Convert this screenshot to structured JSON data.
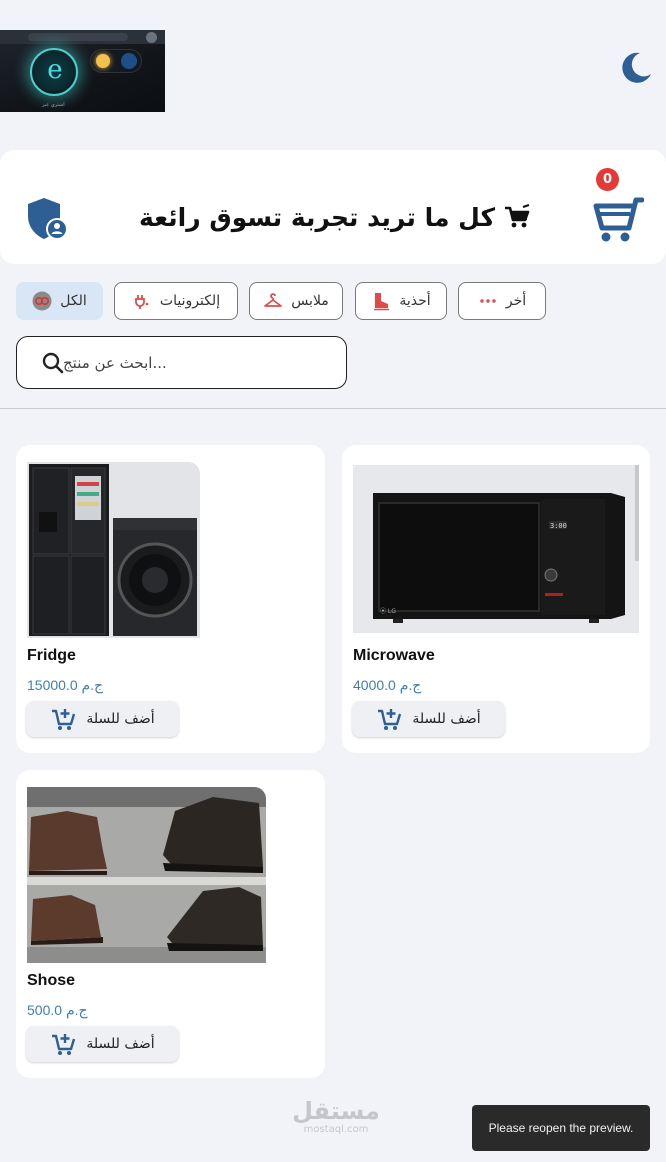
{
  "banner": {
    "tagline": "اشتري عبر",
    "logo_letter": "e"
  },
  "theme": {
    "icon": "moon-icon"
  },
  "header": {
    "title": "كل ما تريد تجربة تسوق رائعة",
    "cart_count": "0",
    "cart_icon": "cart-icon",
    "account_icon": "shield-user-icon"
  },
  "categories": [
    {
      "label": "الكل",
      "icon": "all-icon",
      "active": true
    },
    {
      "label": "إلكترونيات",
      "icon": "plug-icon",
      "active": false
    },
    {
      "label": "ملابس",
      "icon": "hanger-icon",
      "active": false
    },
    {
      "label": "أحذية",
      "icon": "boot-icon",
      "active": false
    },
    {
      "label": "أخر",
      "icon": "dots-icon",
      "active": false
    }
  ],
  "search": {
    "placeholder": "ابحث عن منتج..."
  },
  "products": [
    {
      "name": "Microwave",
      "price": "4000.0 ج.م",
      "add_label": "أضف للسلة"
    },
    {
      "name": "Fridge",
      "price": "15000.0 ج.م",
      "add_label": "أضف للسلة"
    },
    {
      "name": "Shose",
      "price": "500.0 ج.م",
      "add_label": "أضف للسلة"
    }
  ],
  "watermark": {
    "main": "مستقل",
    "sub": "mostaql.com"
  },
  "toast": {
    "message": "Please reopen the preview."
  },
  "colors": {
    "accent": "#2d5f95",
    "badge": "#e53935",
    "price": "#3f7fb0",
    "chip_active": "#d9e6f5",
    "background": "#f2f3f8"
  }
}
